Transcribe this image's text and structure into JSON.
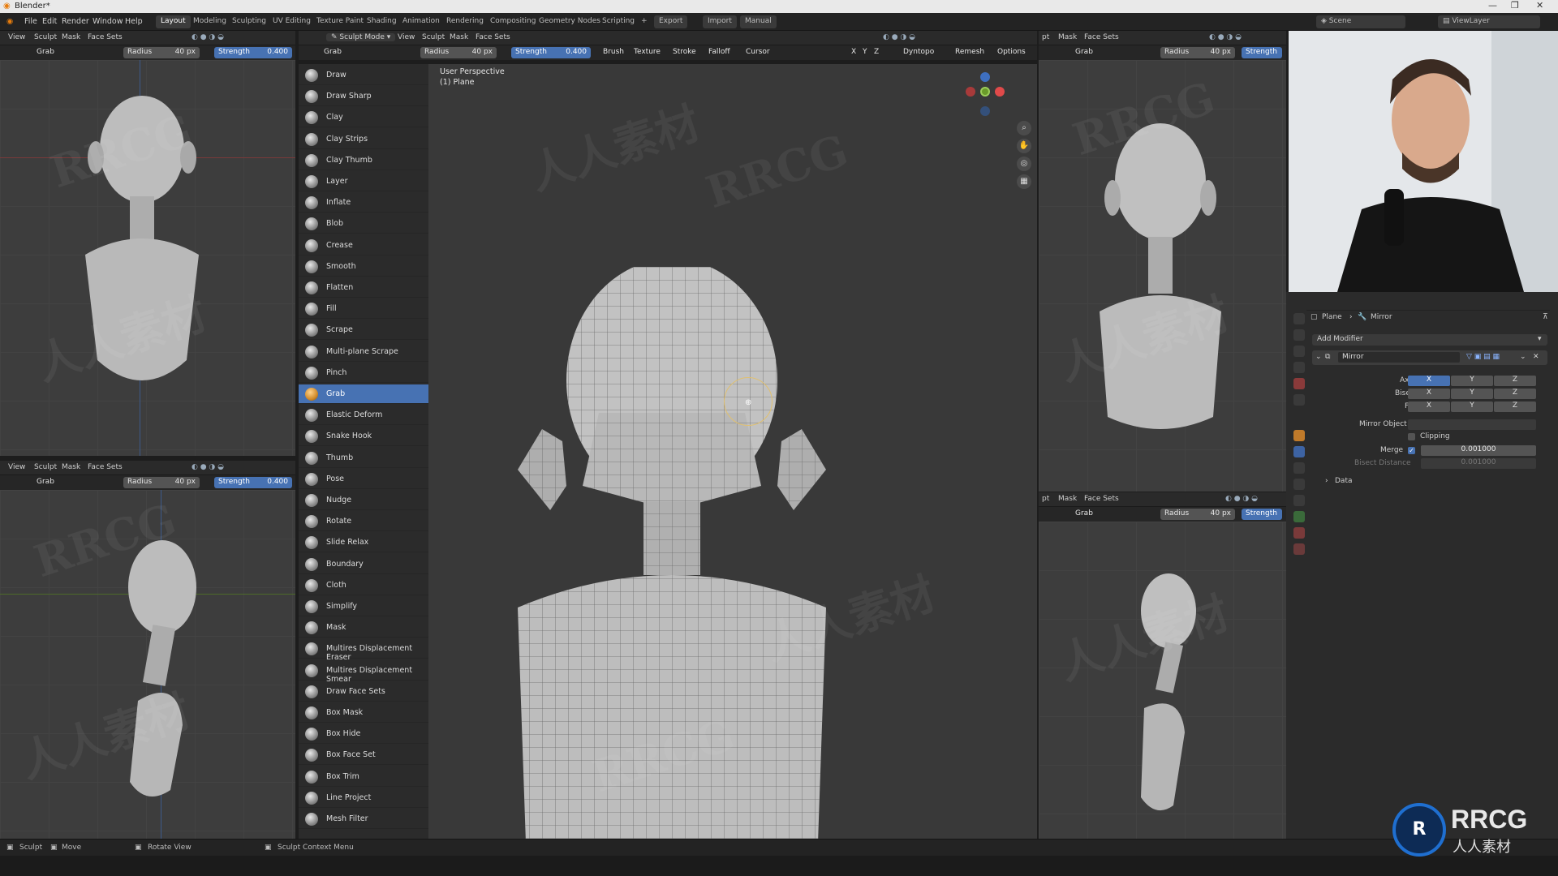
{
  "title_bar": {
    "title": "Blender*",
    "controls": [
      "—",
      "❐",
      "✕"
    ]
  },
  "top_menu": {
    "items": [
      "File",
      "Edit",
      "Render",
      "Window",
      "Help"
    ],
    "workspaces": [
      "Layout",
      "Modeling",
      "Sculpting",
      "UV Editing",
      "Texture Paint",
      "Shading",
      "Animation",
      "Rendering",
      "Compositing",
      "Geometry Nodes",
      "Scripting"
    ],
    "active_workspace": "Layout",
    "add_tab": "+",
    "buttons": [
      "Export",
      "Import",
      "Manual"
    ],
    "scene": "Scene",
    "view_layer": "ViewLayer"
  },
  "viewport_header": {
    "menus": [
      "View",
      "Sculpt",
      "Mask",
      "Face Sets"
    ],
    "mode": "Sculpt Mode"
  },
  "main_header_menus": [
    "View",
    "Sculpt",
    "Mask",
    "Face Sets"
  ],
  "right_header_menus": [
    "pt",
    "Mask",
    "Face Sets"
  ],
  "tool_settings": {
    "brush": "Grab",
    "radius_label": "Radius",
    "radius_value": "40 px",
    "strength_label": "Strength",
    "strength_value": "0.400",
    "dropdowns": [
      "Brush",
      "Texture",
      "Stroke",
      "Falloff",
      "Cursor"
    ],
    "axes": [
      "X",
      "Y",
      "Z"
    ],
    "right_dropdowns": [
      "Dyntopo",
      "Remesh",
      "Options"
    ]
  },
  "main_viewport": {
    "perspective": "User Perspective",
    "object": "(1) Plane"
  },
  "brushes": [
    "Draw",
    "Draw Sharp",
    "Clay",
    "Clay Strips",
    "Clay Thumb",
    "Layer",
    "Inflate",
    "Blob",
    "Crease",
    "Smooth",
    "Flatten",
    "Fill",
    "Scrape",
    "Multi-plane Scrape",
    "Pinch",
    "Grab",
    "Elastic Deform",
    "Snake Hook",
    "Thumb",
    "Pose",
    "Nudge",
    "Rotate",
    "Slide Relax",
    "Boundary",
    "Cloth",
    "Simplify",
    "Mask",
    "Multires Displacement Eraser",
    "Multires Displacement Smear",
    "Draw Face Sets",
    "Box Mask",
    "Box Hide",
    "Box Face Set",
    "Box Trim",
    "Line Project",
    "Mesh Filter"
  ],
  "selected_brush": "Grab",
  "properties": {
    "breadcrumb_object": "Plane",
    "breadcrumb_modifier": "Mirror",
    "add_modifier": "Add Modifier",
    "modifier_name": "Mirror",
    "axis_label": "Axis",
    "bisect_label": "Bisect",
    "flip_label": "Flip",
    "axis_letters": [
      "X",
      "Y",
      "Z"
    ],
    "axis_enabled": [
      true,
      false,
      false
    ],
    "mirror_object_label": "Mirror Object",
    "clipping_label": "Clipping",
    "clipping_checked": false,
    "merge_label": "Merge",
    "merge_checked": true,
    "merge_value": "0.001000",
    "bisect_distance_label": "Bisect Distance",
    "bisect_distance_value": "0.001000",
    "data_label": "Data"
  },
  "status_bar": {
    "items": [
      "Sculpt",
      "Move",
      "Rotate View",
      "Sculpt Context Menu"
    ]
  },
  "watermarks": [
    "RRCG",
    "人人素材"
  ],
  "logo": {
    "text": "RRCG",
    "subtext": "人人素材"
  },
  "colors": {
    "accent": "#4772b3",
    "viewport": "#3d3d3d",
    "panel": "#2b2b2b"
  }
}
